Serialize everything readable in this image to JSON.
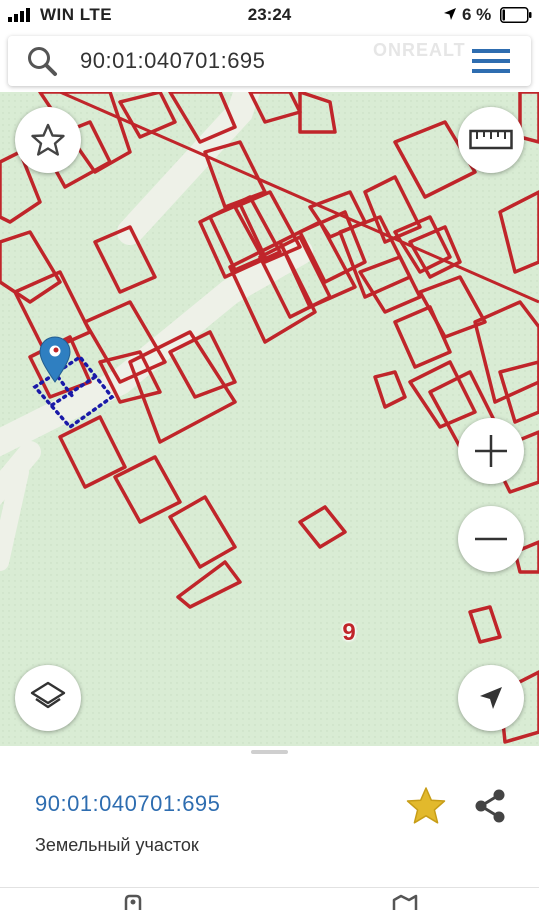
{
  "status_bar": {
    "carrier": "WIN LTE",
    "time": "23:24",
    "battery_percent": "6 %"
  },
  "search": {
    "value": "90:01:040701:695",
    "watermark": "ONREALT"
  },
  "map": {
    "area_label": "9",
    "buttons": {
      "favorite": "star-outline-icon",
      "ruler": "ruler-icon",
      "zoom_in": "plus-icon",
      "zoom_out": "minus-icon",
      "layers": "layers-icon",
      "locate": "navigation-arrow-icon"
    },
    "colors": {
      "background": "#d9ecd4",
      "road": "#eef1e8",
      "parcel_outline": "#c0252a",
      "selected_outline": "#1a1aa8",
      "marker": "#2f7fc1"
    }
  },
  "panel": {
    "parcel_id": "90:01:040701:695",
    "parcel_type": "Земельный участок",
    "favorite_color": "#e2b92c"
  }
}
